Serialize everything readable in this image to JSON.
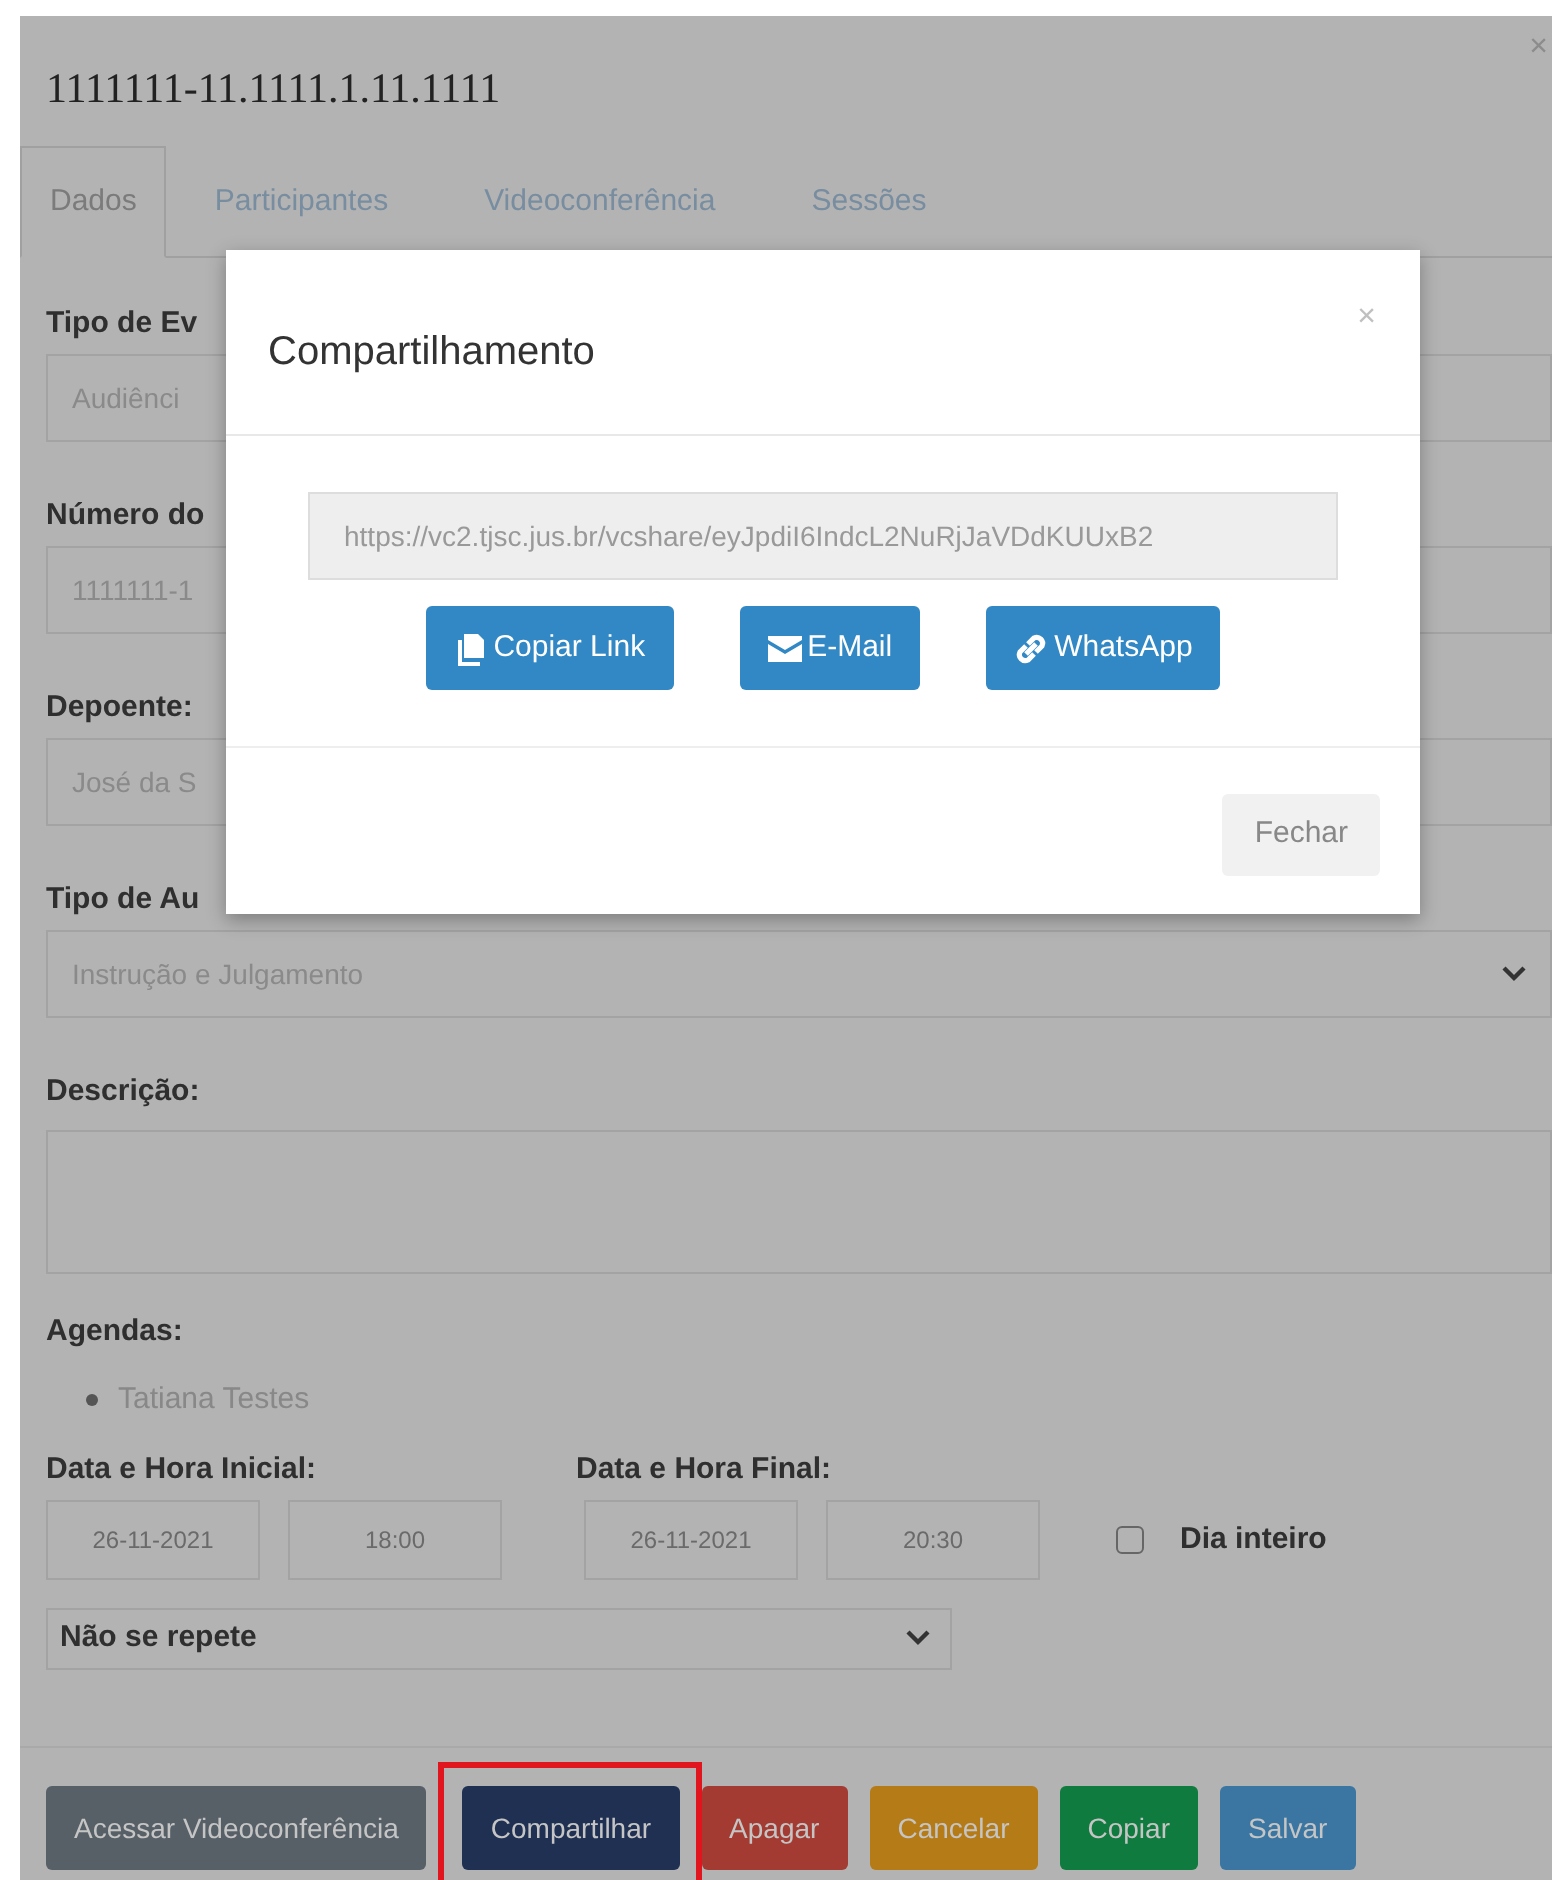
{
  "window": {
    "title": "1111111-11.1111.1.11.1111",
    "close": "×"
  },
  "tabs": [
    {
      "label": "Dados",
      "selected": true
    },
    {
      "label": "Participantes",
      "selected": false
    },
    {
      "label": "Videoconferência",
      "selected": false
    },
    {
      "label": "Sessões",
      "selected": false
    }
  ],
  "fields": [
    {
      "label": "Tipo de Ev",
      "kind": "input",
      "value": "Audiênci"
    },
    {
      "label": "Número do",
      "kind": "input",
      "value": "1111111-1"
    },
    {
      "label": "Depoente:",
      "kind": "input",
      "value": "José da S"
    },
    {
      "label": "Tipo de Au",
      "kind": "select",
      "value": "Instrução e Julgamento"
    },
    {
      "label": "Descrição:",
      "kind": "textarea"
    }
  ],
  "agendas": {
    "label": "Agendas:",
    "items": [
      "Tatiana Testes"
    ]
  },
  "schedule": {
    "start": {
      "label": "Data e Hora Inicial:",
      "date": "26-11-2021",
      "time": "18:00"
    },
    "end": {
      "label": "Data e Hora Final:",
      "date": "26-11-2021",
      "time": "20:30"
    },
    "all_day": {
      "label": "Dia inteiro",
      "checked": false
    },
    "repeat": "Não se repete"
  },
  "buttons": [
    {
      "label": "Acessar Videoconferência",
      "color": "#575f67",
      "highlighted": false
    },
    {
      "label": "Compartilhar",
      "color": "#1f3052",
      "highlighted": true
    },
    {
      "label": "Apagar",
      "color": "#a33b33",
      "highlighted": false
    },
    {
      "label": "Cancelar",
      "color": "#b57b17",
      "highlighted": false
    },
    {
      "label": "Copiar",
      "color": "#107b3f",
      "highlighted": false
    },
    {
      "label": "Salvar",
      "color": "#3a76a1",
      "highlighted": false
    }
  ],
  "share_dialog": {
    "title": "Compartilhamento",
    "close": "×",
    "link": "https://vc2.tjsc.jus.br/vcshare/eyJpdiI6IndcL2NuRjJaVDdKUUxB2",
    "actions": [
      {
        "label": "Copiar Link",
        "kind": "copy"
      },
      {
        "label": "E-Mail",
        "kind": "mail"
      },
      {
        "label": "WhatsApp",
        "kind": "link"
      }
    ],
    "close_button": "Fechar"
  }
}
